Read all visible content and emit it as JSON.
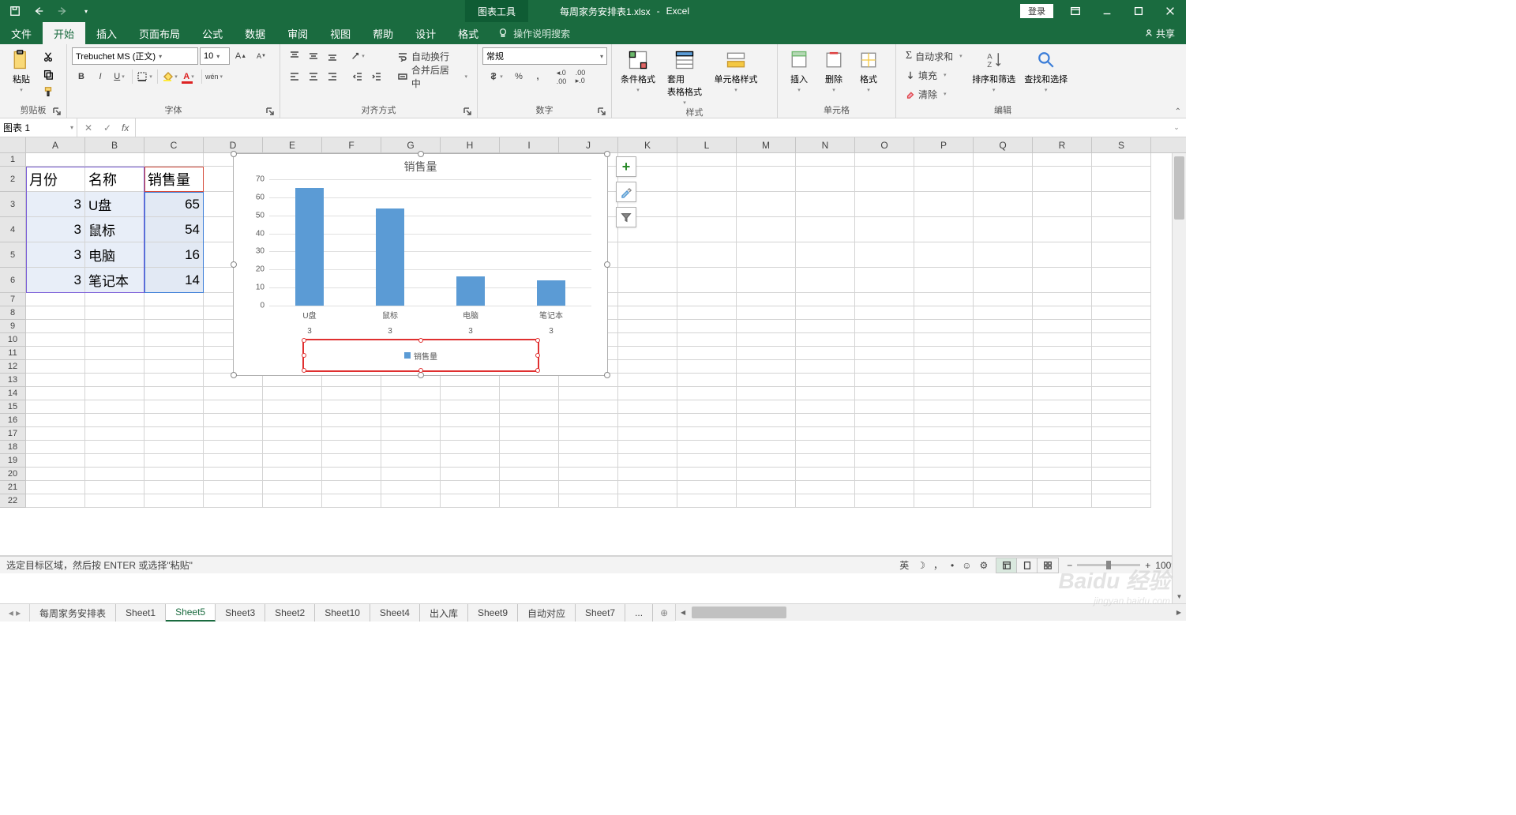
{
  "title": {
    "chart_tools": "图表工具",
    "filename": "每周家务安排表1.xlsx",
    "app": "Excel",
    "login": "登录"
  },
  "tabs": {
    "file": "文件",
    "home": "开始",
    "insert": "插入",
    "page_layout": "页面布局",
    "formulas": "公式",
    "data": "数据",
    "review": "审阅",
    "view": "视图",
    "help": "帮助",
    "design": "设计",
    "format": "格式",
    "tell_me": "操作说明搜索",
    "share": "共享"
  },
  "ribbon": {
    "paste": "粘贴",
    "clipboard": "剪贴板",
    "font_name": "Trebuchet MS (正文)",
    "font_size": "10",
    "font": "字体",
    "wrap": "自动换行",
    "merge": "合并后居中",
    "align": "对齐方式",
    "format_general": "常规",
    "number": "数字",
    "cond_format": "条件格式",
    "table_format": "套用\n表格格式",
    "cell_styles": "单元格样式",
    "styles": "样式",
    "insert_cells": "插入",
    "delete_cells": "删除",
    "format_cells": "格式",
    "cells": "单元格",
    "autosum": "自动求和",
    "fill": "填充",
    "clear": "清除",
    "sort_filter": "排序和筛选",
    "find_select": "查找和选择",
    "editing": "编辑"
  },
  "name_box": "图表 1",
  "columns": [
    "A",
    "B",
    "C",
    "D",
    "E",
    "F",
    "G",
    "H",
    "I",
    "J",
    "K",
    "L",
    "M",
    "N",
    "O",
    "P",
    "Q",
    "R",
    "S"
  ],
  "table_headers": {
    "month": "月份",
    "name": "名称",
    "sales": "销售量"
  },
  "table_data": [
    {
      "month": "3",
      "name": "U盘",
      "sales": "65"
    },
    {
      "month": "3",
      "name": "鼠标",
      "sales": "54"
    },
    {
      "month": "3",
      "name": "电脑",
      "sales": "16"
    },
    {
      "month": "3",
      "name": "笔记本",
      "sales": "14"
    }
  ],
  "chart_data": {
    "type": "bar",
    "title": "销售量",
    "categories": [
      "U盘",
      "鼠标",
      "电脑",
      "笔记本"
    ],
    "secondary_categories": [
      "3",
      "3",
      "3",
      "3"
    ],
    "values": [
      65,
      54,
      16,
      14
    ],
    "series_name": "销售量",
    "ylim": [
      0,
      70
    ],
    "yticks": [
      0,
      10,
      20,
      30,
      40,
      50,
      60,
      70
    ],
    "bar_color": "#5b9bd5"
  },
  "sheets": {
    "s1": "每周家务安排表",
    "s2": "Sheet1",
    "s3": "Sheet5",
    "s4": "Sheet3",
    "s5": "Sheet2",
    "s6": "Sheet10",
    "s7": "Sheet4",
    "s8": "出入库",
    "s9": "Sheet9",
    "s10": "自动对应",
    "s11": "Sheet7",
    "more": "..."
  },
  "status": {
    "msg": "选定目标区域，然后按 ENTER 或选择\"粘贴\"",
    "ime": "英",
    "zoom": "100%"
  },
  "watermark": {
    "main": "Baidu 经验",
    "sub": "jingyan.baidu.com"
  }
}
